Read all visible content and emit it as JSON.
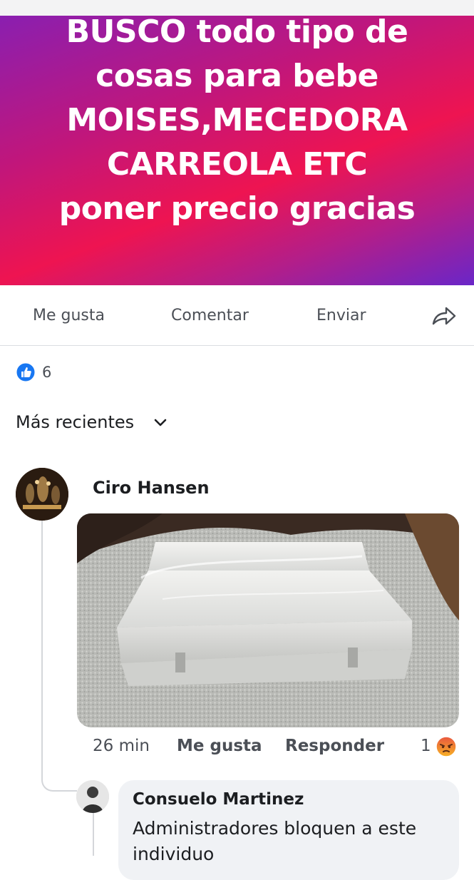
{
  "post": {
    "lines": [
      "BUSCO  todo tipo de",
      "cosas para bebe",
      "MOISES,MECEDORA",
      "CARREOLA ETC",
      "poner precio gracias"
    ],
    "gradient_colors": [
      "#8a1fb0",
      "#ee1451",
      "#6a26c8"
    ]
  },
  "actions": {
    "like": "Me gusta",
    "comment": "Comentar",
    "send": "Enviar",
    "share_icon": "share-arrow-icon"
  },
  "reactions": {
    "icon": "like-thumb-icon",
    "count": "6",
    "like_color": "#1877f2"
  },
  "sort": {
    "label": "Más recientes",
    "icon": "chevron-down-icon"
  },
  "comments": [
    {
      "author": "Ciro Hansen",
      "attachment": "photo of a small white box wrapped in plastic on carpet",
      "time": "26 min",
      "like_label": "Me gusta",
      "reply_label": "Responder",
      "reaction_count": "1",
      "reaction_icon": "angry-face-icon"
    }
  ],
  "replies": [
    {
      "author": "Consuelo Martinez",
      "text": "Administradores bloquen a este individuo"
    }
  ]
}
